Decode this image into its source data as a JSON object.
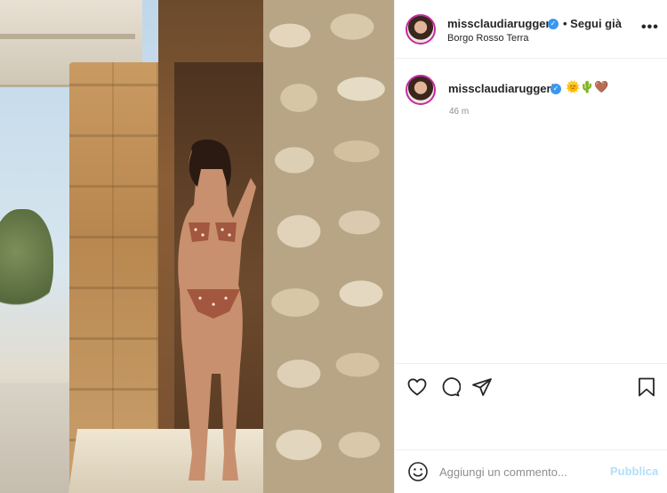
{
  "post": {
    "author": {
      "username": "missclaudiaruggeri",
      "verified": true,
      "follow_label": "• Segui già",
      "location": "Borgo Rosso Terra"
    },
    "caption": {
      "username": "missclaudiaruggeri",
      "emojis": "🌞🌵🤎",
      "time_ago": "46 m"
    },
    "more_label": "•••",
    "image_icon": "photo-post",
    "actions": {
      "icons": [
        "heart-icon",
        "comment-icon",
        "share-icon",
        "bookmark-icon"
      ]
    },
    "comment": {
      "placeholder": "Aggiungi un commento...",
      "publish_label": "Pubblica",
      "emoji_icon": "smiley-icon"
    }
  },
  "colors": {
    "avatar_ring": "#c32aa3",
    "verified": "#3897f0",
    "publish_disabled": "#b2dffc",
    "muted_text": "#8e8e8e",
    "text": "#262626"
  }
}
